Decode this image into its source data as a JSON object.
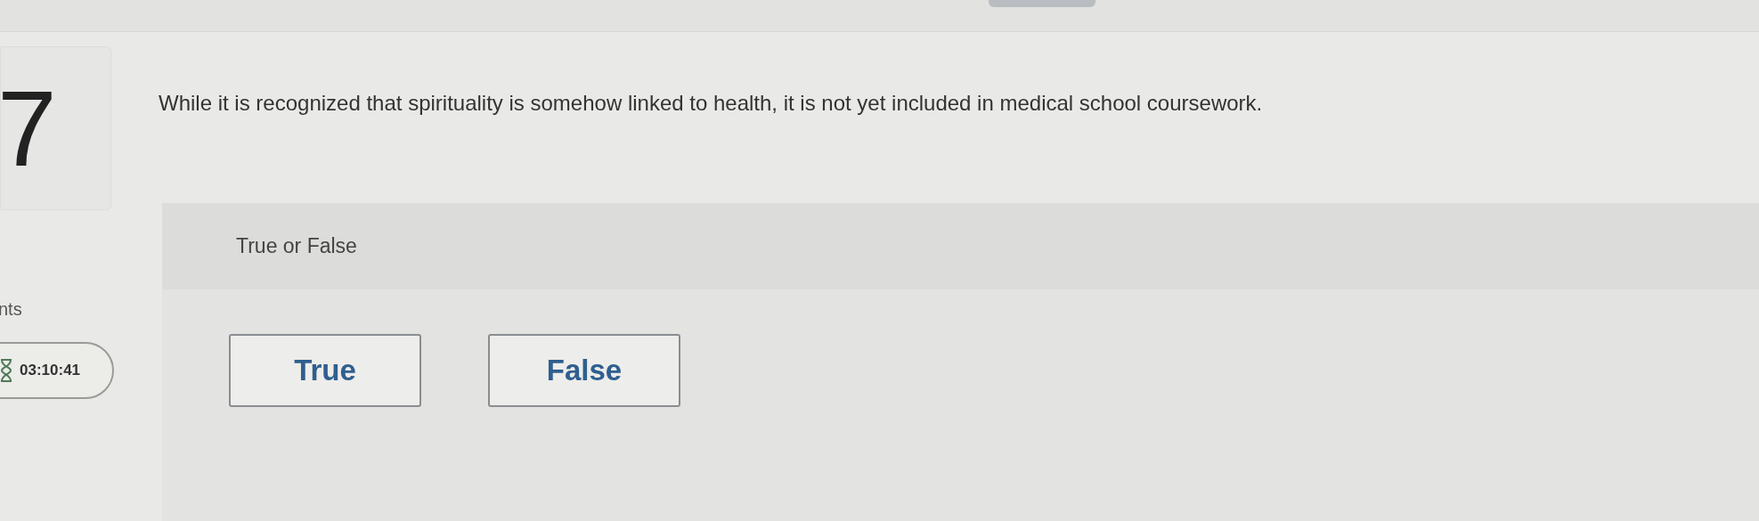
{
  "question": {
    "number": "7",
    "points_label": "nts",
    "timer": "03:10:41",
    "text": "While it is recognized that spirituality is somehow linked to health, it is not yet included in medical school coursework."
  },
  "answer_panel": {
    "prompt": "True or False",
    "options": [
      {
        "label": "True"
      },
      {
        "label": "False"
      }
    ]
  }
}
